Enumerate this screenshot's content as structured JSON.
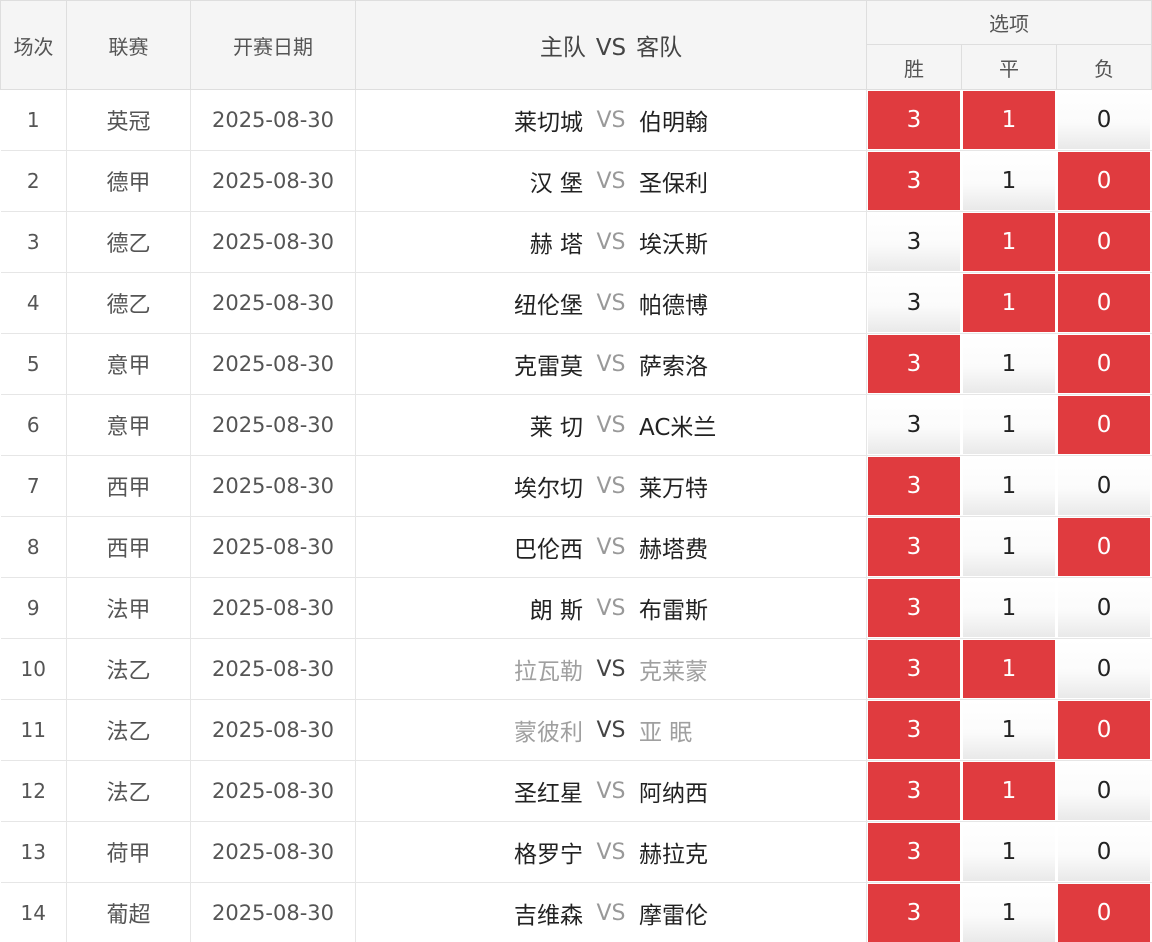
{
  "header": {
    "num": "场次",
    "league": "联赛",
    "date": "开赛日期",
    "home": "主队",
    "vs": "VS",
    "away": "客队",
    "options": "选项",
    "win": "胜",
    "draw": "平",
    "lose": "负"
  },
  "colors": {
    "selected": "#e03b3f",
    "header_bg": "#f5f5f5"
  },
  "rows": [
    {
      "num": "1",
      "league": "英冠",
      "date": "2025-08-30",
      "home": "莱切城",
      "vs": "VS",
      "away": "伯明翰",
      "opts": [
        "3",
        "1",
        "0"
      ],
      "sel": [
        true,
        true,
        false
      ],
      "muted": false
    },
    {
      "num": "2",
      "league": "德甲",
      "date": "2025-08-30",
      "home": "汉 堡",
      "vs": "VS",
      "away": "圣保利",
      "opts": [
        "3",
        "1",
        "0"
      ],
      "sel": [
        true,
        false,
        true
      ],
      "muted": false
    },
    {
      "num": "3",
      "league": "德乙",
      "date": "2025-08-30",
      "home": "赫 塔",
      "vs": "VS",
      "away": "埃沃斯",
      "opts": [
        "3",
        "1",
        "0"
      ],
      "sel": [
        false,
        true,
        true
      ],
      "muted": false
    },
    {
      "num": "4",
      "league": "德乙",
      "date": "2025-08-30",
      "home": "纽伦堡",
      "vs": "VS",
      "away": "帕德博",
      "opts": [
        "3",
        "1",
        "0"
      ],
      "sel": [
        false,
        true,
        true
      ],
      "muted": false
    },
    {
      "num": "5",
      "league": "意甲",
      "date": "2025-08-30",
      "home": "克雷莫",
      "vs": "VS",
      "away": "萨索洛",
      "opts": [
        "3",
        "1",
        "0"
      ],
      "sel": [
        true,
        false,
        true
      ],
      "muted": false
    },
    {
      "num": "6",
      "league": "意甲",
      "date": "2025-08-30",
      "home": "莱 切",
      "vs": "VS",
      "away": "AC米兰",
      "opts": [
        "3",
        "1",
        "0"
      ],
      "sel": [
        false,
        false,
        true
      ],
      "muted": false
    },
    {
      "num": "7",
      "league": "西甲",
      "date": "2025-08-30",
      "home": "埃尔切",
      "vs": "VS",
      "away": "莱万特",
      "opts": [
        "3",
        "1",
        "0"
      ],
      "sel": [
        true,
        false,
        false
      ],
      "muted": false
    },
    {
      "num": "8",
      "league": "西甲",
      "date": "2025-08-30",
      "home": "巴伦西",
      "vs": "VS",
      "away": "赫塔费",
      "opts": [
        "3",
        "1",
        "0"
      ],
      "sel": [
        true,
        false,
        true
      ],
      "muted": false
    },
    {
      "num": "9",
      "league": "法甲",
      "date": "2025-08-30",
      "home": "朗 斯",
      "vs": "VS",
      "away": "布雷斯",
      "opts": [
        "3",
        "1",
        "0"
      ],
      "sel": [
        true,
        false,
        false
      ],
      "muted": false
    },
    {
      "num": "10",
      "league": "法乙",
      "date": "2025-08-30",
      "home": "拉瓦勒",
      "vs": "VS",
      "away": "克莱蒙",
      "opts": [
        "3",
        "1",
        "0"
      ],
      "sel": [
        true,
        true,
        false
      ],
      "muted": true
    },
    {
      "num": "11",
      "league": "法乙",
      "date": "2025-08-30",
      "home": "蒙彼利",
      "vs": "VS",
      "away": "亚 眠",
      "opts": [
        "3",
        "1",
        "0"
      ],
      "sel": [
        true,
        false,
        true
      ],
      "muted": true
    },
    {
      "num": "12",
      "league": "法乙",
      "date": "2025-08-30",
      "home": "圣红星",
      "vs": "VS",
      "away": "阿纳西",
      "opts": [
        "3",
        "1",
        "0"
      ],
      "sel": [
        true,
        true,
        false
      ],
      "muted": false
    },
    {
      "num": "13",
      "league": "荷甲",
      "date": "2025-08-30",
      "home": "格罗宁",
      "vs": "VS",
      "away": "赫拉克",
      "opts": [
        "3",
        "1",
        "0"
      ],
      "sel": [
        true,
        false,
        false
      ],
      "muted": false
    },
    {
      "num": "14",
      "league": "葡超",
      "date": "2025-08-30",
      "home": "吉维森",
      "vs": "VS",
      "away": "摩雷伦",
      "opts": [
        "3",
        "1",
        "0"
      ],
      "sel": [
        true,
        false,
        true
      ],
      "muted": false
    }
  ]
}
